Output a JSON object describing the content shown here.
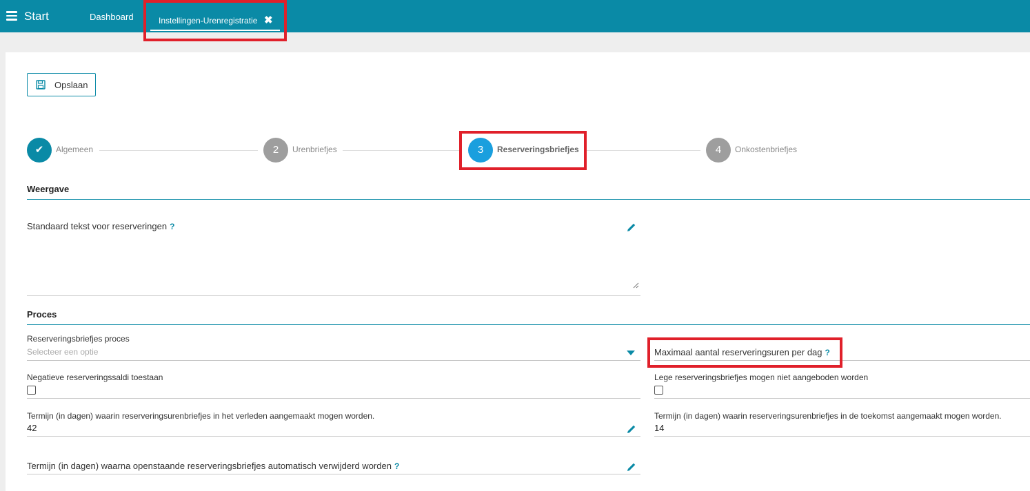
{
  "topbar": {
    "start_label": "Start",
    "tabs": [
      {
        "label": "Dashboard"
      },
      {
        "label": "Instellingen-Urenregistratie",
        "close": "✖"
      }
    ]
  },
  "toolbar": {
    "save_label": "Opslaan"
  },
  "stepper": {
    "steps": [
      {
        "number": "✔",
        "label": "Algemeen",
        "state": "done"
      },
      {
        "number": "2",
        "label": "Urenbriefjes",
        "state": "inactive"
      },
      {
        "number": "3",
        "label": "Reserveringsbriefjes",
        "state": "active"
      },
      {
        "number": "4",
        "label": "Onkostenbriefjes",
        "state": "inactive"
      }
    ]
  },
  "weergave": {
    "title": "Weergave",
    "standaard_tekst_label": "Standaard tekst voor reserveringen",
    "help": "?"
  },
  "proces": {
    "title": "Proces",
    "proces_label": "Reserveringsbriefjes proces",
    "proces_placeholder": "Selecteer een optie",
    "max_uren_label": "Maximaal aantal reserveringsuren per dag",
    "help": "?",
    "negatief_label": "Negatieve reserveringssaldi toestaan",
    "lege_label": "Lege reserveringsbriefjes mogen niet aangeboden worden",
    "verleden_label": "Termijn (in dagen) waarin reserveringsurenbriefjes in het verleden aangemaakt mogen worden.",
    "verleden_value": "42",
    "toekomst_label": "Termijn (in dagen) waarin reserveringsurenbriefjes in de toekomst aangemaakt mogen worden.",
    "toekomst_value": "14",
    "verwijderd_label": "Termijn (in dagen) waarna openstaande reserveringsbriefjes automatisch verwijderd worden"
  },
  "colors": {
    "accent": "#0a8aa6",
    "active_step": "#1a9fde",
    "highlight": "#e0202a"
  }
}
